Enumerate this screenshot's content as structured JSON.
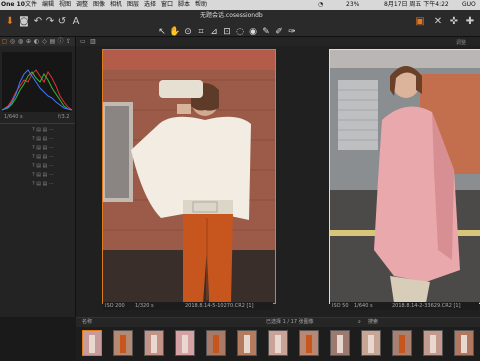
{
  "menubar": {
    "app": "One 10",
    "items": [
      "文件",
      "编辑",
      "视图",
      "调整",
      "图像",
      "相机",
      "图层",
      "选择",
      "窗口",
      "脚本",
      "帮助"
    ],
    "status": {
      "battery": "23%",
      "date": "8月17日 周五 下午4:22",
      "user": "GUO"
    }
  },
  "window": {
    "title": "无题会话.cosessiondb"
  },
  "toolbar": {
    "icons": [
      "import-icon",
      "camera-icon",
      "undo-icon",
      "redo-icon",
      "redo-alt-icon",
      "text-icon"
    ],
    "cursor_tools": [
      "select-cursor-icon",
      "pan-icon",
      "loupe-icon",
      "crop-icon",
      "straighten-icon",
      "keystone-icon",
      "spot-icon",
      "clone-icon",
      "brush-icon",
      "picker-icon",
      "annotate-icon"
    ],
    "right_icons": [
      "export-icon",
      "picker-cross-icon",
      "copy-adjust-icon",
      "apply-adjust-icon"
    ]
  },
  "left_panel": {
    "tool_tabs": [
      "library-tab-icon",
      "capture-tab-icon",
      "lens-tab-icon",
      "color-tab-icon",
      "exposure-tab-icon",
      "details-tab-icon",
      "local-tab-icon",
      "metadata-tab-icon",
      "output-tab-icon"
    ],
    "exposure": {
      "shutter": "1/640 s",
      "aperture": "f/3.2"
    },
    "rows": [
      {
        "icons": "? ▤ ▤ ⋯"
      },
      {
        "icons": "? ▤ ▤ ⋯"
      },
      {
        "icons": "? ▤ ▤ ⋯"
      },
      {
        "icons": "? ▤ ▤ ⋯"
      },
      {
        "icons": "? ▤ ▤ ⋯"
      },
      {
        "icons": "? ▤ ▤ ⋯"
      },
      {
        "icons": "? ▤ ▤ ⋯"
      }
    ]
  },
  "viewer": {
    "toolbar_label": "调整",
    "photo_left": {
      "iso": "ISO 200",
      "shutter": "1/320 s",
      "file": "2018.8.14-5-10270.CR2 [1]"
    },
    "photo_right": {
      "iso": "ISO 50",
      "shutter": "1/640 s",
      "file": "2018.8.14-2-33629.CR2 [1]"
    }
  },
  "browser": {
    "label": "名称",
    "filter": "已选择 1 / 17 张图像",
    "search_label": "搜索",
    "thumb_count": 13
  },
  "colors": {
    "accent": "#e07a1e",
    "panel": "#232323"
  }
}
